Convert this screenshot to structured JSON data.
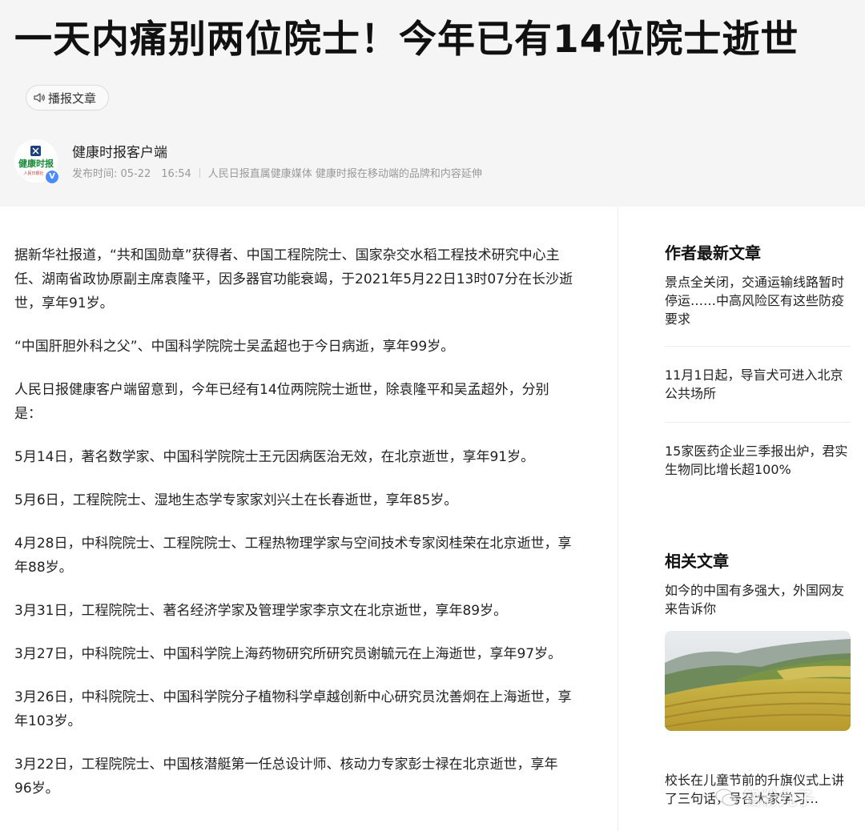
{
  "article": {
    "title": "一天内痛别两位院士！今年已有14位院士逝世",
    "tts_label": "播报文章",
    "source": {
      "name": "健康时报客户端",
      "logo_text": "健康时报",
      "logo_sub": "人民日报社",
      "verified_mark": "V"
    },
    "publish_time": "发布时间: 05-22　16:54",
    "source_desc": "人民日报直属健康媒体 健康时报在移动端的品牌和内容延伸",
    "paragraphs": [
      "据新华社报道，“共和国勋章”获得者、中国工程院院士、国家杂交水稻工程技术研究中心主任、湖南省政协原副主席袁隆平，因多器官功能衰竭，于2021年5月22日13时07分在长沙逝世，享年91岁。",
      "“中国肝胆外科之父”、中国科学院院士吴孟超也于今日病逝，享年99岁。",
      "人民日报健康客户端留意到，今年已经有14位两院院士逝世，除袁隆平和吴孟超外，分别是：",
      "5月14日，著名数学家、中国科学院院士王元因病医治无效，在北京逝世，享年91岁。",
      "5月6日，工程院院士、湿地生态学专家家刘兴土在长春逝世，享年85岁。",
      "4月28日，中科院院士、工程院院士、工程热物理学家与空间技术专家闵桂荣在北京逝世，享年88岁。",
      "3月31日，工程院院士、著名经济学家及管理学家李京文在北京逝世，享年89岁。",
      "3月27日，中科院院士、中国科学院上海药物研究所研究员谢毓元在上海逝世，享年97岁。",
      "3月26日，中科院院士、中国科学院分子植物科学卓越创新中心研究员沈善炯在上海逝世，享年103岁。",
      "3月22日，工程院院士、中国核潜艇第一任总设计师、核动力专家彭士禄在北京逝世，享年96岁。"
    ]
  },
  "sidebar": {
    "author_latest_title": "作者最新文章",
    "author_latest": [
      "景点全关闭，交通运输线路暂时停运……中高风险区有这些防疫要求",
      "11月1日起，导盲犬可进入北京公共场所",
      "15家医药企业三季报出炉，君实生物同比增长超100%"
    ],
    "related_title": "相关文章",
    "related": [
      "如今的中国有多强大，外国网友来告诉你",
      "校长在儿童节前的升旗仪式上讲了三句话，号召大家学习…"
    ]
  },
  "watermark": {
    "text": "铅粉九子"
  },
  "colors": {
    "header_bg": "#f5f5f5",
    "verified_blue": "#4a8cff",
    "logo_green": "#1a8a3a"
  },
  "icons": {
    "tts": "speaker-icon",
    "verified": "verified-badge-icon"
  }
}
